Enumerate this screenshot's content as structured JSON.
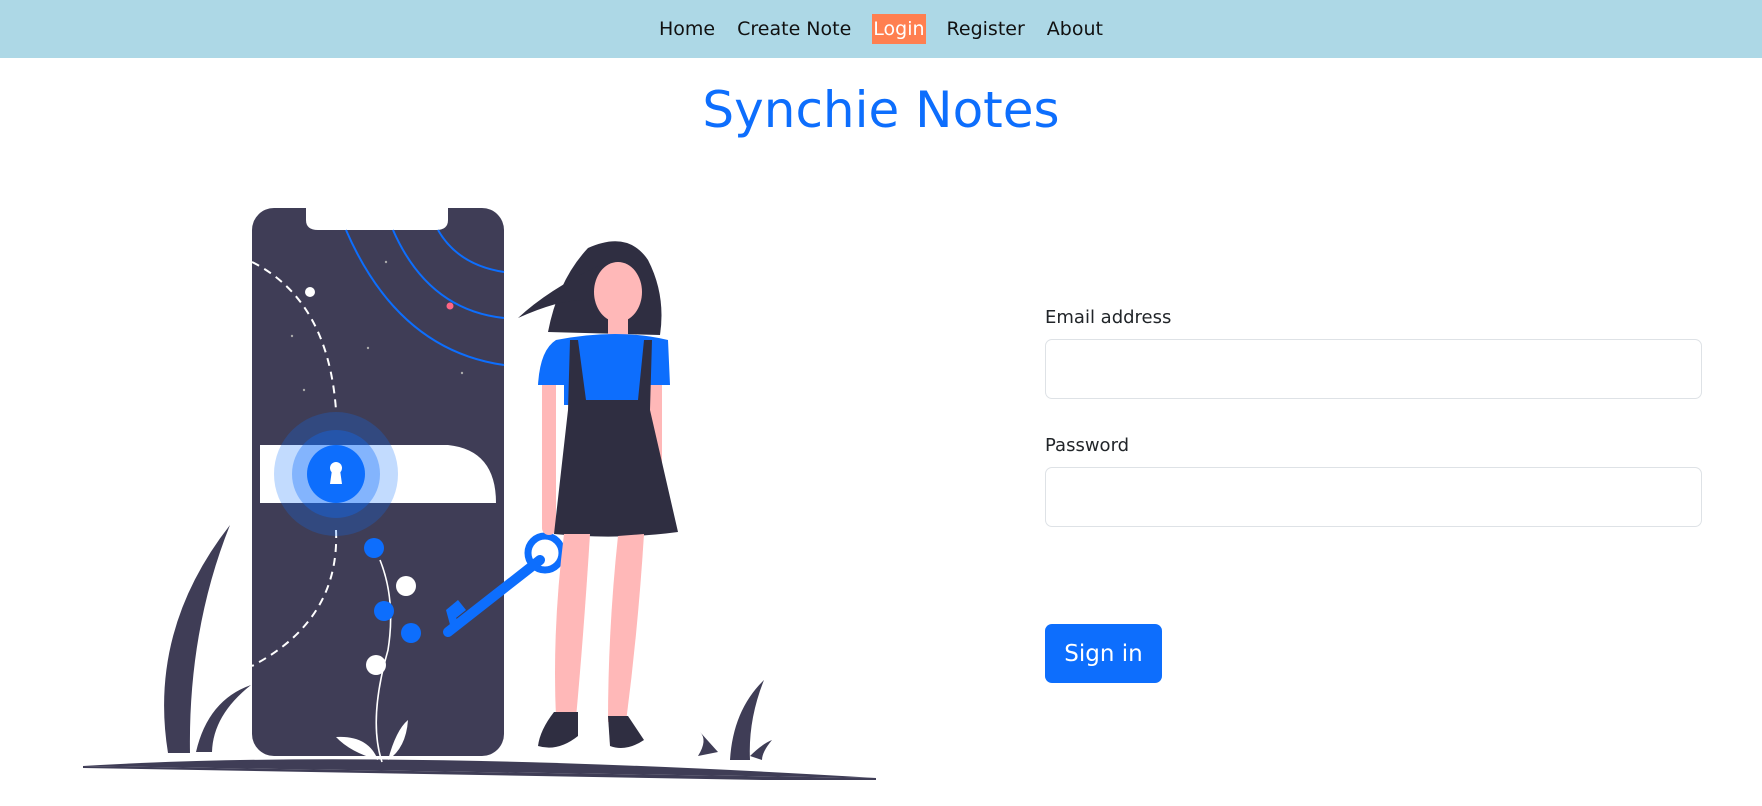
{
  "nav": {
    "items": [
      {
        "label": "Home",
        "active": false
      },
      {
        "label": "Create Note",
        "active": false
      },
      {
        "label": "Login",
        "active": true
      },
      {
        "label": "Register",
        "active": false
      },
      {
        "label": "About",
        "active": false
      }
    ]
  },
  "page": {
    "title": "Synchie Notes"
  },
  "form": {
    "email_label": "Email address",
    "email_value": "",
    "password_label": "Password",
    "password_value": "",
    "submit_label": "Sign in"
  },
  "colors": {
    "navbar_bg": "#add8e6",
    "active_nav_bg": "#ff7f50",
    "brand_blue": "#0d6efd",
    "dark": "#3f3d56"
  }
}
